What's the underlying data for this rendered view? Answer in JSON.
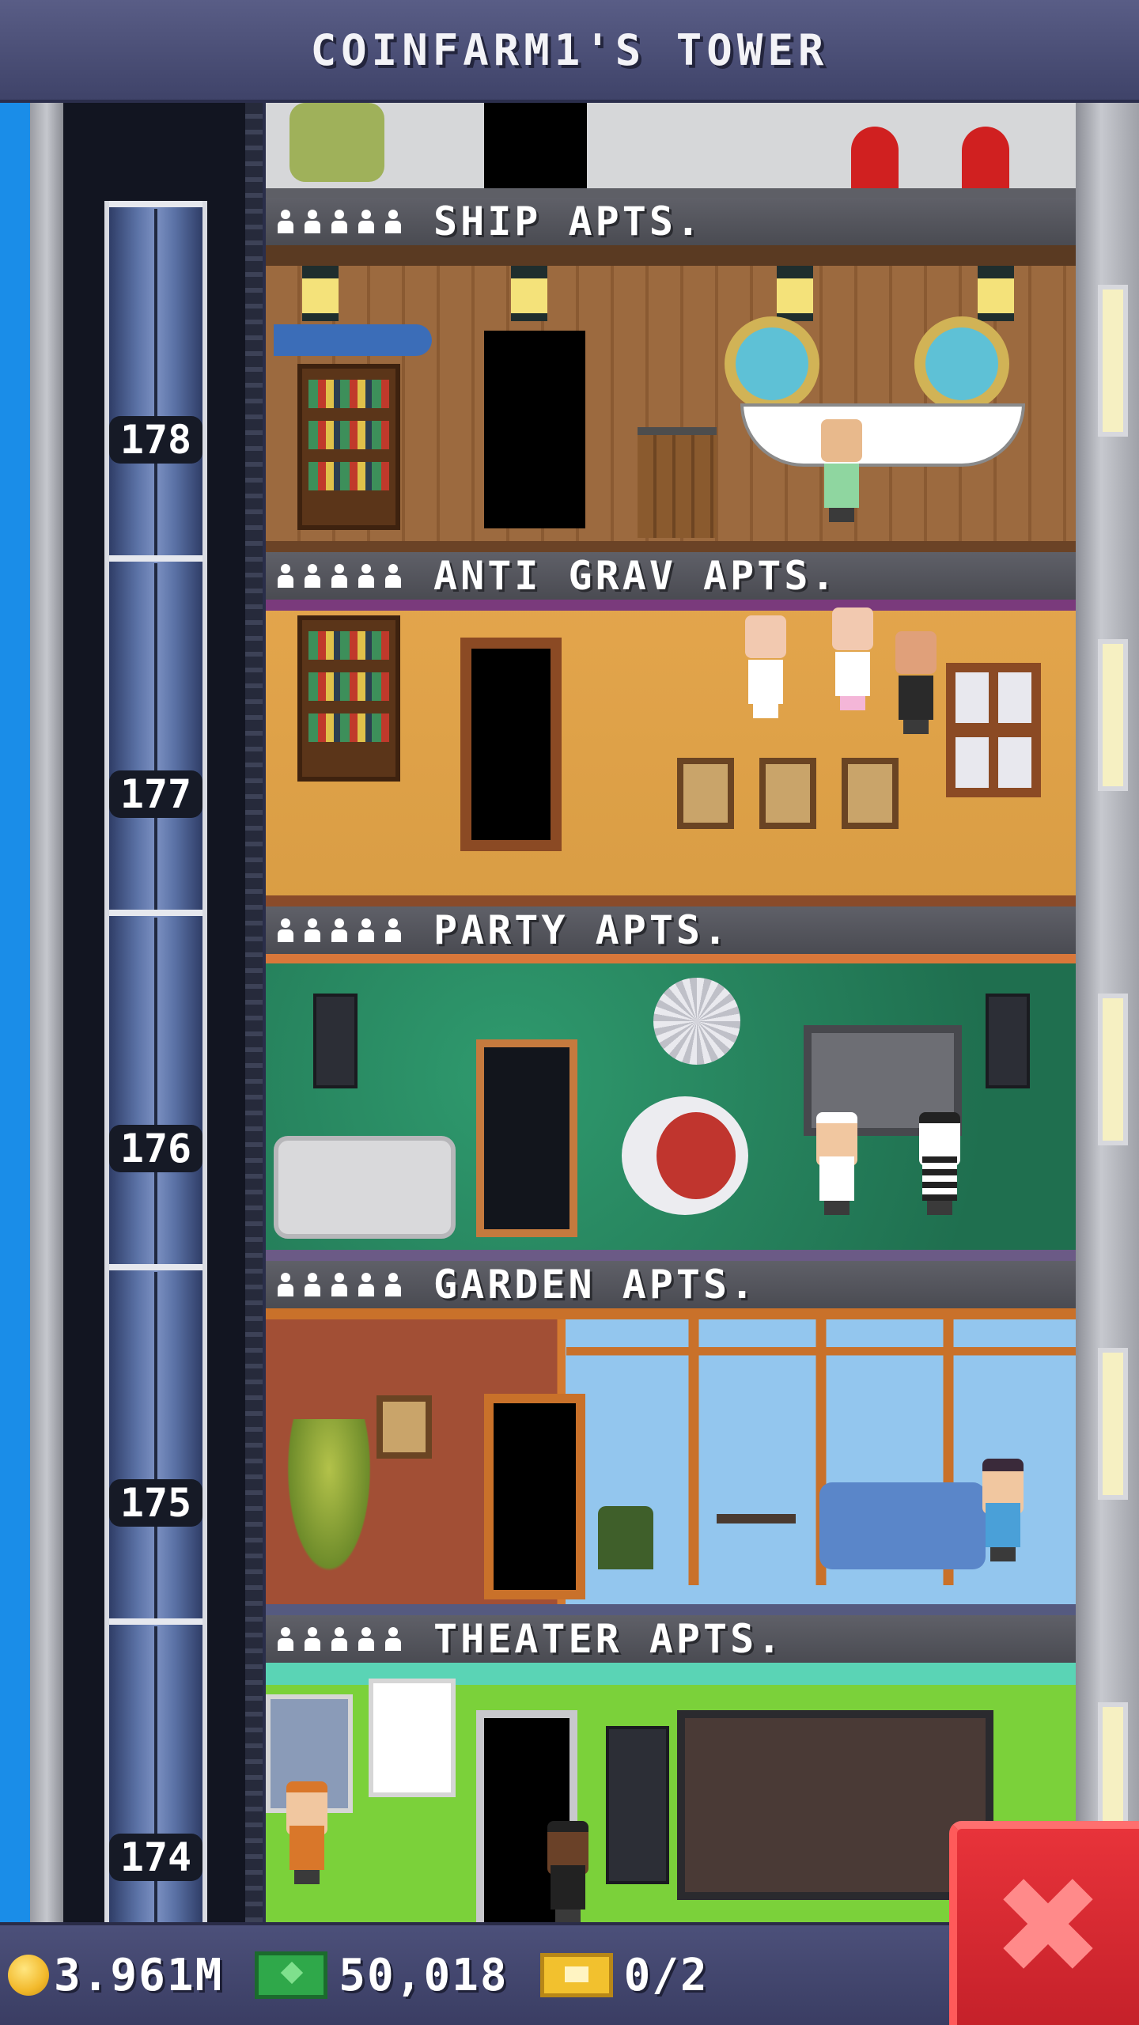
{
  "header": {
    "title": "COINFARM1'S TOWER"
  },
  "floors": [
    {
      "name": "SHIP APTS.",
      "number": "178",
      "theme": "ship"
    },
    {
      "name": "ANTI GRAV APTS.",
      "number": "177",
      "theme": "antigrav"
    },
    {
      "name": "PARTY APTS.",
      "number": "176",
      "theme": "party"
    },
    {
      "name": "GARDEN APTS.",
      "number": "175",
      "theme": "garden"
    },
    {
      "name": "THEATER APTS.",
      "number": "174",
      "theme": "theater"
    }
  ],
  "stats": {
    "coins": "3.961M",
    "bux": "50,018",
    "tickets": "0/2"
  },
  "icons": {
    "coin": "coin-icon",
    "bux": "bux-icon",
    "ticket": "ticket-icon",
    "close": "close-icon",
    "resident": "resident-icon"
  },
  "colors": {
    "header": "#4a4e76",
    "sky": "#1a8de8",
    "close_button": "#d52a31"
  },
  "close_button": {
    "glyph": "✖"
  }
}
